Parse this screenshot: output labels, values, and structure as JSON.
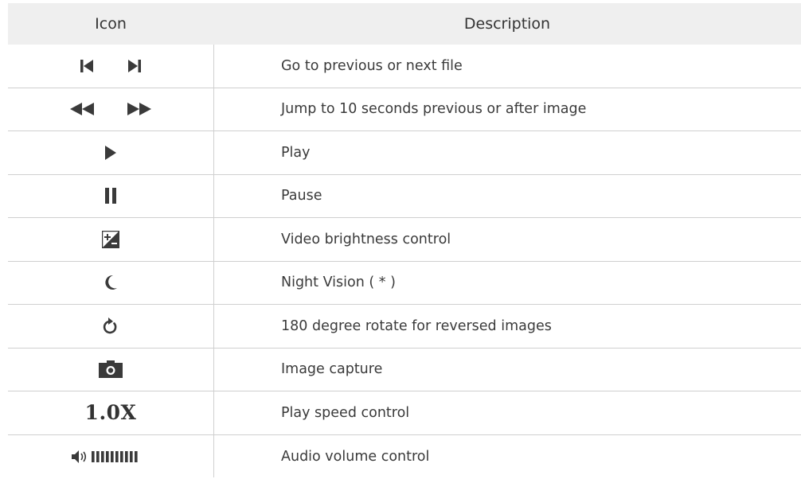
{
  "header": {
    "icon_label": "Icon",
    "description_label": "Description"
  },
  "rows": [
    {
      "icons": [
        "skip-previous-icon",
        "skip-next-icon"
      ],
      "description": "Go to previous or next file"
    },
    {
      "icons": [
        "rewind-icon",
        "fast-forward-icon"
      ],
      "description": "Jump to 10 seconds previous or after image"
    },
    {
      "icons": [
        "play-icon"
      ],
      "description": "Play"
    },
    {
      "icons": [
        "pause-icon"
      ],
      "description": "Pause"
    },
    {
      "icons": [
        "brightness-icon"
      ],
      "description": "Video brightness control"
    },
    {
      "icons": [
        "moon-icon"
      ],
      "description": "Night Vision ( * )"
    },
    {
      "icons": [
        "rotate-icon"
      ],
      "description": "180 degree rotate for reversed images"
    },
    {
      "icons": [
        "camera-icon"
      ],
      "description": "Image capture"
    },
    {
      "icons": [
        "play-speed-icon"
      ],
      "description": "Play speed control",
      "icon_text": "1.0X"
    },
    {
      "icons": [
        "volume-icon"
      ],
      "description": "Audio volume control"
    }
  ],
  "colors": {
    "header_bg": "#efefef",
    "icon": "#3a3a3a",
    "divider": "#cfcfcf"
  }
}
